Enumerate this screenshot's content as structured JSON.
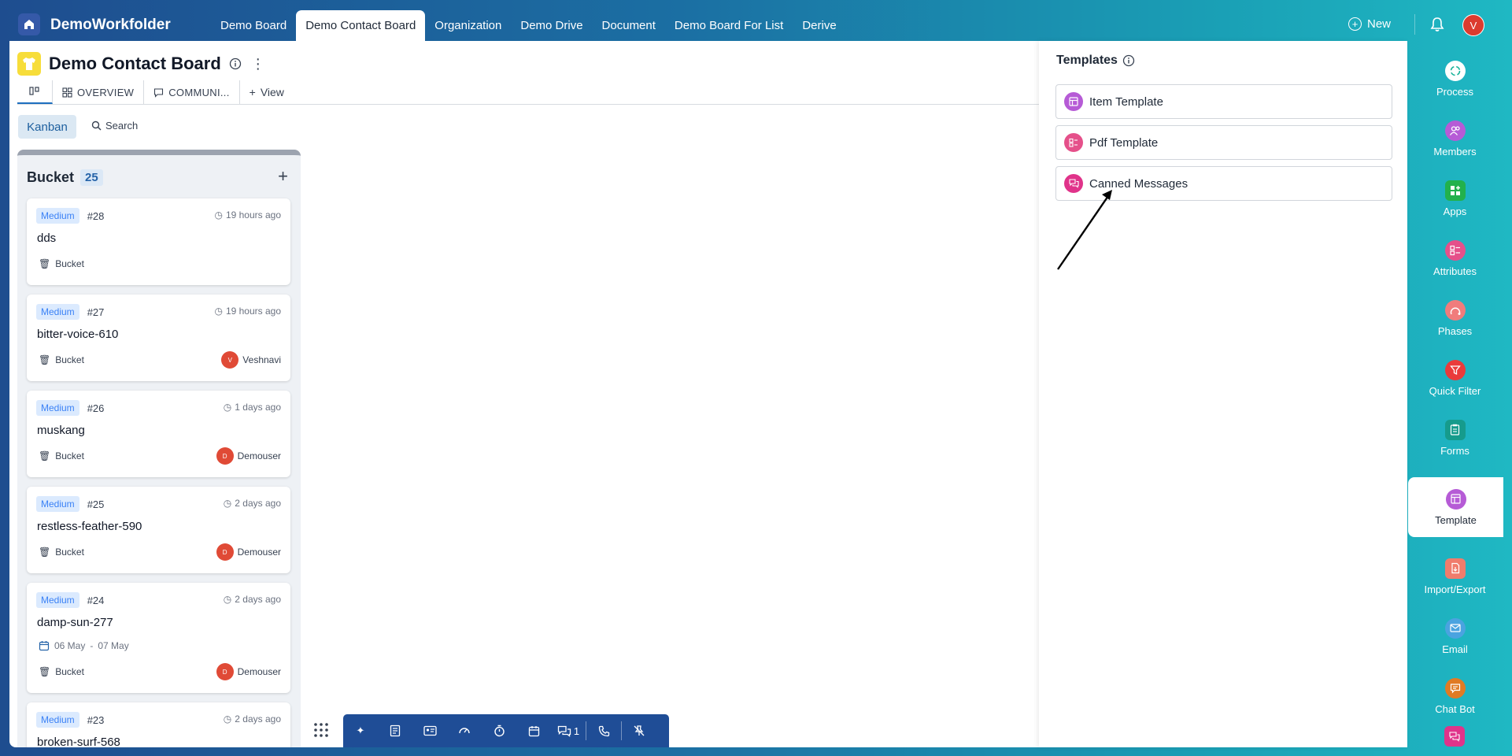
{
  "app": {
    "brand": "DemoWorkfolder",
    "user_initial": "V"
  },
  "nav": {
    "tabs": [
      {
        "label": "Demo Board"
      },
      {
        "label": "Demo Contact Board"
      },
      {
        "label": "Organization"
      },
      {
        "label": "Demo Drive"
      },
      {
        "label": "Document"
      },
      {
        "label": "Demo Board For List"
      },
      {
        "label": "Derive"
      }
    ],
    "active_index": 1,
    "new_label": "New"
  },
  "board": {
    "title": "Demo Contact Board",
    "view_tabs": [
      {
        "label": "OVERVIEW"
      },
      {
        "label": "COMMUNI..."
      },
      {
        "label": "View"
      }
    ],
    "kanban_label": "Kanban",
    "search_label": "Search"
  },
  "bucket": {
    "title": "Bucket",
    "count": "25",
    "cards": [
      {
        "priority": "Medium",
        "number": "#28",
        "ago": "19 hours ago",
        "title": "dds",
        "bucket": "Bucket",
        "user": "",
        "user_initial": ""
      },
      {
        "priority": "Medium",
        "number": "#27",
        "ago": "19 hours ago",
        "title": "bitter-voice-610",
        "bucket": "Bucket",
        "user": "Veshnavi",
        "user_initial": "V"
      },
      {
        "priority": "Medium",
        "number": "#26",
        "ago": "1 days ago",
        "title": "muskang",
        "bucket": "Bucket",
        "user": "Demouser",
        "user_initial": "D"
      },
      {
        "priority": "Medium",
        "number": "#25",
        "ago": "2 days ago",
        "title": "restless-feather-590",
        "bucket": "Bucket",
        "user": "Demouser",
        "user_initial": "D"
      },
      {
        "priority": "Medium",
        "number": "#24",
        "ago": "2 days ago",
        "title": "damp-sun-277",
        "bucket": "Bucket",
        "user": "Demouser",
        "user_initial": "D",
        "date_from": "06 May",
        "date_sep": "-",
        "date_to": "07 May"
      },
      {
        "priority": "Medium",
        "number": "#23",
        "ago": "2 days ago",
        "title": "broken-surf-568"
      }
    ]
  },
  "bottom_toolbar": {
    "chat_count": "1"
  },
  "templates": {
    "title": "Templates",
    "items": [
      {
        "label": "Item Template",
        "color": "#b65bd6"
      },
      {
        "label": "Pdf Template",
        "color": "#e5508a"
      },
      {
        "label": "Canned Messages",
        "color": "#e0338a"
      }
    ]
  },
  "sidebar": {
    "items": [
      {
        "label": "Process",
        "color": "#19b39a",
        "icon": "process-icon"
      },
      {
        "label": "Members",
        "color": "#b65bd6",
        "icon": "members-icon"
      },
      {
        "label": "Apps",
        "color": "#22b14c",
        "icon": "apps-icon"
      },
      {
        "label": "Attributes",
        "color": "#e5508a",
        "icon": "attributes-icon"
      },
      {
        "label": "Phases",
        "color": "#f07c7c",
        "icon": "phases-icon"
      },
      {
        "label": "Quick Filter",
        "color": "#ea3b3b",
        "icon": "filter-icon"
      },
      {
        "label": "Forms",
        "color": "#169b8c",
        "icon": "forms-icon"
      },
      {
        "label": "Template",
        "color": "#b65bd6",
        "icon": "template-icon"
      },
      {
        "label": "Import/Export",
        "color": "#f07c6c",
        "icon": "import-export-icon"
      },
      {
        "label": "Email",
        "color": "#4aa3e0",
        "icon": "email-icon"
      },
      {
        "label": "Chat Bot",
        "color": "#e07b24",
        "icon": "chatbot-icon"
      }
    ],
    "active_index": 7
  }
}
